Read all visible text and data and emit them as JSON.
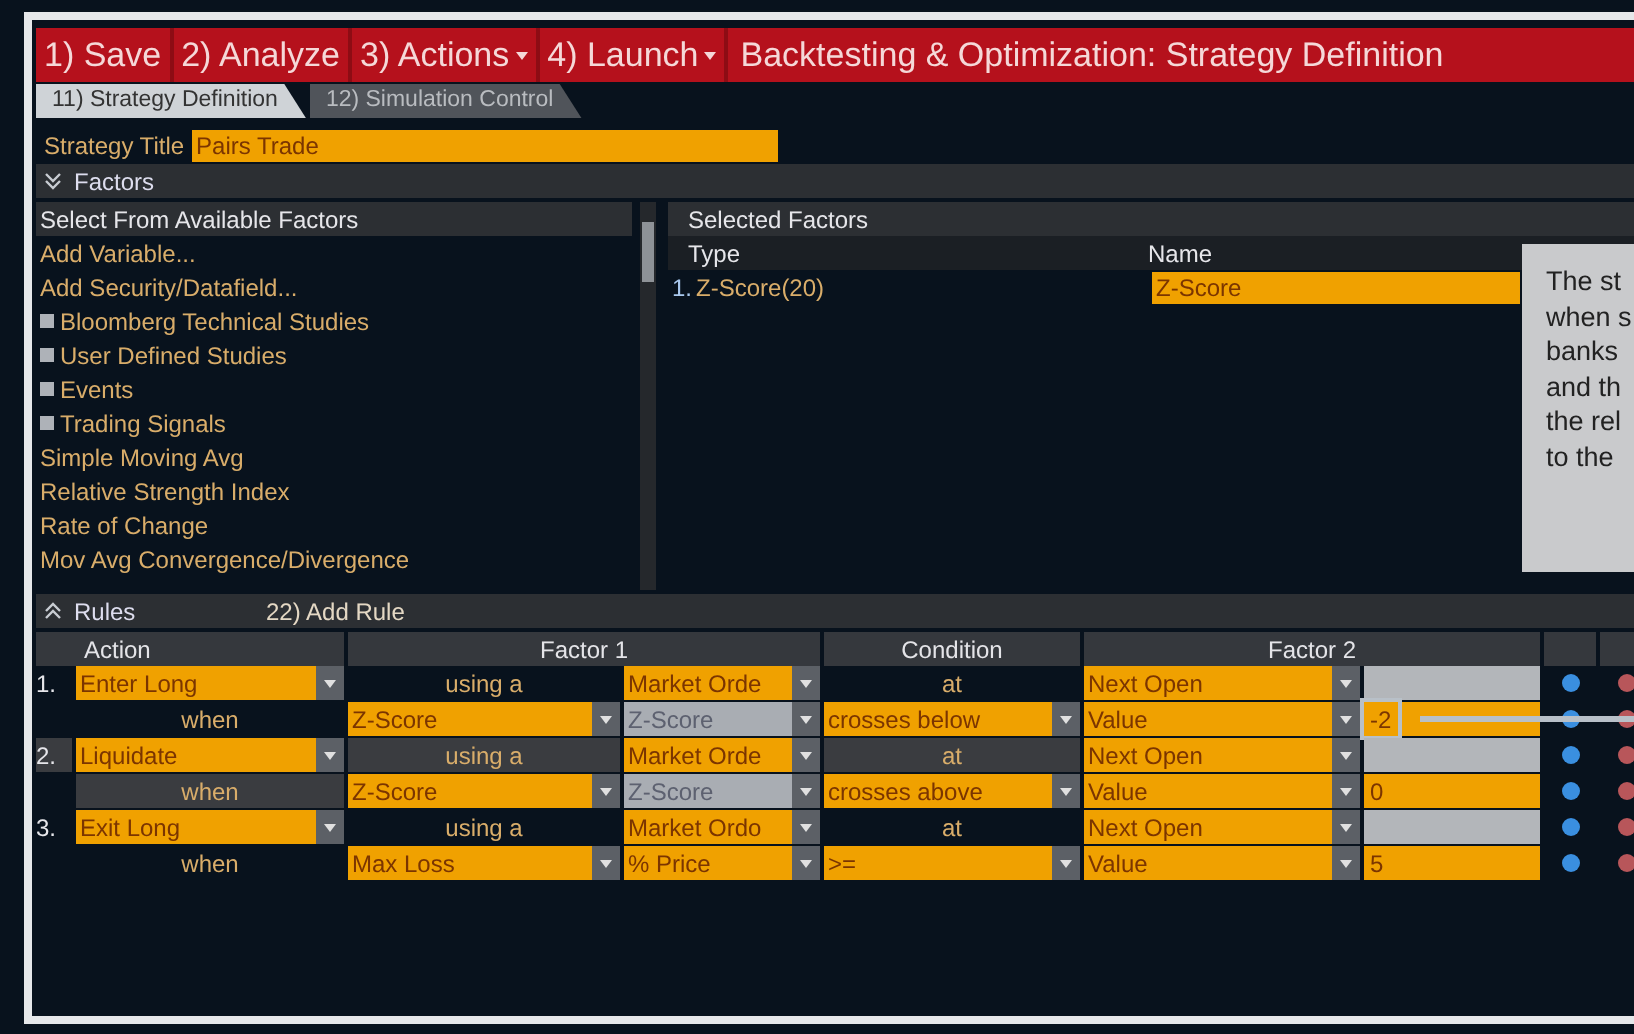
{
  "menu": [
    {
      "label": "1) Save",
      "dropdown": false
    },
    {
      "label": "2) Analyze",
      "dropdown": false
    },
    {
      "label": "3) Actions",
      "dropdown": true
    },
    {
      "label": "4) Launch",
      "dropdown": true
    }
  ],
  "title": "Backtesting & Optimization: Strategy Definition",
  "tabs": [
    {
      "label": "11) Strategy Definition",
      "selected": true
    },
    {
      "label": "12) Simulation Control",
      "selected": false
    }
  ],
  "strategy_title": {
    "label": "Strategy Title",
    "value": "Pairs Trade"
  },
  "factors": {
    "header": "Factors",
    "available": {
      "header": "Select From Available Factors",
      "items": [
        {
          "kind": "action",
          "label": "Add Variable..."
        },
        {
          "kind": "action",
          "label": "Add Security/Datafield..."
        },
        {
          "kind": "group",
          "label": "Bloomberg Technical Studies"
        },
        {
          "kind": "group",
          "label": "User Defined Studies"
        },
        {
          "kind": "group",
          "label": "Events"
        },
        {
          "kind": "group",
          "label": "Trading Signals"
        },
        {
          "kind": "item",
          "label": "Simple Moving Avg"
        },
        {
          "kind": "item",
          "label": "Relative Strength Index"
        },
        {
          "kind": "item",
          "label": "Rate of Change"
        },
        {
          "kind": "item",
          "label": "Mov Avg Convergence/Divergence"
        }
      ]
    },
    "selected": {
      "header": "Selected Factors",
      "columns": [
        "Type",
        "Name"
      ],
      "rows": [
        {
          "number": "1.",
          "type": "Z-Score(20)",
          "name": "Z-Score"
        }
      ]
    }
  },
  "tooltip": {
    "lines": [
      "The st",
      "when s",
      "banks",
      "and th",
      "the rel",
      "to the"
    ]
  },
  "rules": {
    "header": "Rules",
    "add_button": "22) Add Rule",
    "columns": [
      "Action",
      "Factor 1",
      "Condition",
      "Factor 2"
    ],
    "items": [
      {
        "number": "1.",
        "lines": [
          [
            {
              "kind": "dropdown",
              "text": "Enter Long",
              "disabled": false
            },
            {
              "kind": "label",
              "text": "using a"
            },
            {
              "kind": "dropdown",
              "text": "Market Orde",
              "disabled": false
            },
            {
              "kind": "label",
              "text": "at"
            },
            {
              "kind": "dropdown",
              "text": "Next Open",
              "disabled": false
            },
            {
              "kind": "field",
              "disabled": true
            }
          ],
          [
            {
              "kind": "label",
              "text": "when"
            },
            {
              "kind": "dropdown",
              "text": "Z-Score",
              "disabled": false
            },
            {
              "kind": "dropdown",
              "text": "Z-Score",
              "disabled": true
            },
            {
              "kind": "dropdown",
              "text": "crosses below",
              "disabled": false
            },
            {
              "kind": "dropdown",
              "text": "Value",
              "disabled": false
            },
            {
              "kind": "field",
              "text": "-2",
              "disabled": false,
              "focused": true
            }
          ]
        ]
      },
      {
        "number": "2.",
        "lines": [
          [
            {
              "kind": "dropdown",
              "text": "Liquidate",
              "disabled": false
            },
            {
              "kind": "label",
              "text": "using a"
            },
            {
              "kind": "dropdown",
              "text": "Market Orde",
              "disabled": false
            },
            {
              "kind": "label",
              "text": "at"
            },
            {
              "kind": "dropdown",
              "text": "Next Open",
              "disabled": false
            },
            {
              "kind": "field",
              "disabled": true
            }
          ],
          [
            {
              "kind": "label",
              "text": "when"
            },
            {
              "kind": "dropdown",
              "text": "Z-Score",
              "disabled": false
            },
            {
              "kind": "dropdown",
              "text": "Z-Score",
              "disabled": true
            },
            {
              "kind": "dropdown",
              "text": "crosses above",
              "disabled": false
            },
            {
              "kind": "dropdown",
              "text": "Value",
              "disabled": false
            },
            {
              "kind": "field",
              "text": "0",
              "disabled": false,
              "focused": false
            }
          ]
        ]
      },
      {
        "number": "3.",
        "lines": [
          [
            {
              "kind": "dropdown",
              "text": "Exit Long",
              "disabled": false
            },
            {
              "kind": "label",
              "text": "using a"
            },
            {
              "kind": "dropdown",
              "text": "Market Ordo",
              "disabled": false
            },
            {
              "kind": "label",
              "text": "at"
            },
            {
              "kind": "dropdown",
              "text": "Next Open",
              "disabled": false
            },
            {
              "kind": "field",
              "disabled": true
            }
          ],
          [
            {
              "kind": "label",
              "text": "when"
            },
            {
              "kind": "dropdown",
              "text": "Max Loss",
              "disabled": false
            },
            {
              "kind": "dropdown",
              "text": "% Price",
              "disabled": false
            },
            {
              "kind": "dropdown",
              "text": ">=",
              "disabled": false
            },
            {
              "kind": "dropdown",
              "text": "Value",
              "disabled": false
            },
            {
              "kind": "field",
              "text": "5",
              "disabled": false,
              "focused": false
            }
          ]
        ]
      }
    ]
  }
}
